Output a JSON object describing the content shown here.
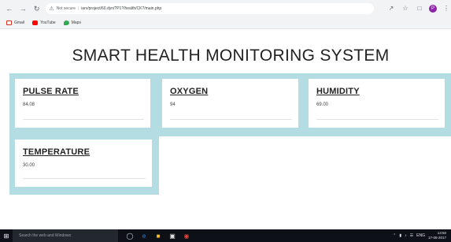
{
  "browser": {
    "security": "Not secure",
    "url": "iarv/project/60.dyn/?P1?/health/CK?/main.php",
    "bookmarks": [
      {
        "label": "Gmail",
        "icon": "gmail-icon"
      },
      {
        "label": "YouTube",
        "icon": "youtube-icon"
      },
      {
        "label": "Maps",
        "icon": "maps-icon"
      }
    ],
    "profile_initial": "P"
  },
  "page": {
    "title": "SMART HEALTH MONITORING SYSTEM",
    "cards": [
      {
        "label": "PULSE RATE",
        "value": "84.08"
      },
      {
        "label": "OXYGEN",
        "value": "94"
      },
      {
        "label": "HUMIDITY",
        "value": "69.00"
      },
      {
        "label": "TEMPERATURE",
        "value": "30.00"
      }
    ],
    "accent": "#b3dde2"
  },
  "taskbar": {
    "search_placeholder": "Search the web and Windows",
    "language": "ENG",
    "time": "13:50",
    "date": "17-08-2017"
  }
}
